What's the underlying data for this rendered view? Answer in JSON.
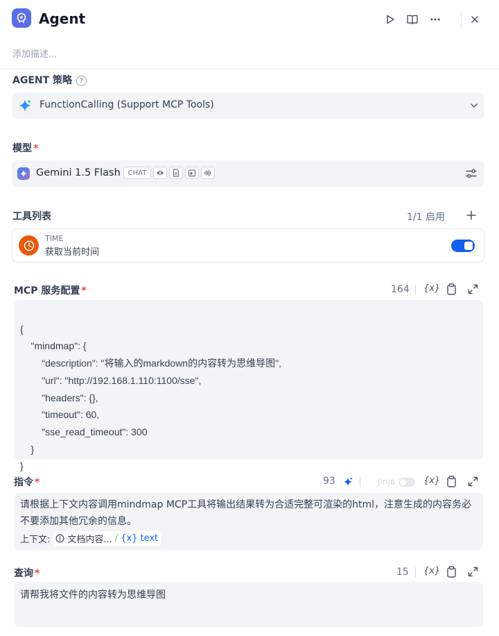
{
  "header": {
    "title": "Agent",
    "description_placeholder": "添加描述...",
    "run_icon": "play-icon",
    "docs_icon": "book-icon",
    "more_icon": "more-icon",
    "close_icon": "close-icon"
  },
  "strategy": {
    "label": "AGENT 策略",
    "value": "FunctionCalling (Support MCP Tools)"
  },
  "model": {
    "label": "模型",
    "name": "Gemini 1.5 Flash",
    "tag": "CHAT"
  },
  "tools": {
    "label": "工具列表",
    "count": "1/1 启用",
    "items": [
      {
        "provider": "TIME",
        "name": "获取当前时间",
        "enabled": true
      }
    ]
  },
  "mcp": {
    "label": "MCP 服务配置",
    "count": "164",
    "var_icon": "{x}",
    "lines": [
      "{",
      "    \"mindmap\": {",
      "        \"description\": \"将输入的markdown的内容转为思维导图\",",
      "        \"url\": \"http://192.168.1.110:1100/sse\",",
      "        \"headers\": {},",
      "        \"timeout\": 60,",
      "        \"sse_read_timeout\": 300",
      "    }",
      "}"
    ]
  },
  "instruction": {
    "label": "指令",
    "count": "93",
    "jinja": "Jinja",
    "var_icon": "{x}",
    "text": "请根据上下文内容调用mindmap MCP工具将输出结果转为合适完整可渲染的html，注意生成的内容务必不要添加其他冗余的信息。",
    "context_label": "上下文:",
    "context_node": "文档内容...",
    "context_sep": "/",
    "context_var": "{x} text"
  },
  "query": {
    "label": "查询",
    "count": "15",
    "var_icon": "{x}",
    "text": "请帮我将文件的内容转为思维导图"
  },
  "colors": {
    "accent": "#155eef",
    "app_icon": "#5b6ee8",
    "time_icon": "#ea580c",
    "required": "#f04438"
  }
}
